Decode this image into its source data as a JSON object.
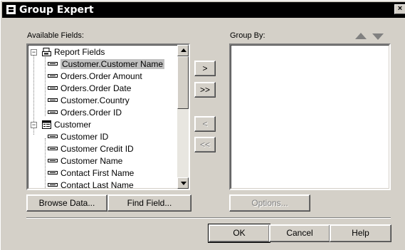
{
  "window": {
    "title": "Group Expert",
    "close_label": "×"
  },
  "available": {
    "label": "Available Fields:",
    "tree": [
      {
        "type": "group",
        "label": "Report Fields",
        "icon": "report-fields-icon",
        "expander": "−"
      },
      {
        "type": "field",
        "label": "Customer.Customer Name",
        "selected": true
      },
      {
        "type": "field",
        "label": "Orders.Order Amount"
      },
      {
        "type": "field",
        "label": "Orders.Order Date"
      },
      {
        "type": "field",
        "label": "Customer.Country"
      },
      {
        "type": "field",
        "label": "Orders.Order ID"
      },
      {
        "type": "group",
        "label": "Customer",
        "icon": "table-icon",
        "expander": "−"
      },
      {
        "type": "field",
        "label": "Customer ID"
      },
      {
        "type": "field",
        "label": "Customer Credit ID"
      },
      {
        "type": "field",
        "label": "Customer Name"
      },
      {
        "type": "field",
        "label": "Contact First Name"
      },
      {
        "type": "field",
        "label": "Contact Last Name"
      }
    ]
  },
  "transfer": {
    "add": ">",
    "add_all": ">>",
    "remove": "<",
    "remove_all": "<<"
  },
  "group_by": {
    "label": "Group By:"
  },
  "buttons": {
    "browse": "Browse Data...",
    "find": "Find Field...",
    "options": "Options...",
    "ok": "OK",
    "cancel": "Cancel",
    "help": "Help"
  }
}
